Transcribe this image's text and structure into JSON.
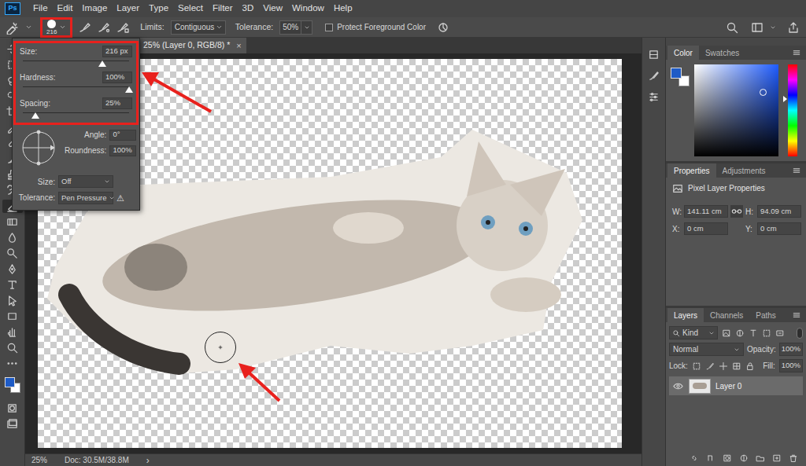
{
  "app": {
    "logo": "Ps"
  },
  "menu": [
    "File",
    "Edit",
    "Image",
    "Layer",
    "Type",
    "Select",
    "Filter",
    "3D",
    "View",
    "Window",
    "Help"
  ],
  "options_bar": {
    "brush_size": "216",
    "limits_label": "Limits:",
    "limits_value": "Contiguous",
    "tolerance_label": "Tolerance:",
    "tolerance_value": "50%",
    "protect_label": "Protect Foreground Color",
    "protect_checked": false
  },
  "brush_panel": {
    "sliders": [
      {
        "label": "Size:",
        "value": "216 px",
        "level": 0.75
      },
      {
        "label": "Hardness:",
        "value": "100%",
        "level": 1
      },
      {
        "label": "Spacing:",
        "value": "25%",
        "level": 0.12
      }
    ],
    "angle_label": "Angle:",
    "angle_value": "0°",
    "roundness_label": "Roundness:",
    "roundness_value": "100%",
    "controls": [
      {
        "label": "Size:",
        "value": "Off",
        "warning": false
      },
      {
        "label": "Tolerance:",
        "value": "Pen Pressure",
        "warning": true
      }
    ],
    "warning_icon": "⚠"
  },
  "document": {
    "tab": "25% (Layer 0, RGB/8) *",
    "close": "×"
  },
  "status_bar": {
    "zoom": "25%",
    "doc": "Doc: 30.5M/38.8M",
    "more": "›"
  },
  "swatches": [
    {
      "name": "foreground",
      "color": "#1e5bc6"
    },
    {
      "name": "background",
      "color": "#ffffff"
    }
  ],
  "color_panel": {
    "tabs": [
      {
        "label": "Color",
        "selected": true
      },
      {
        "label": "Swatches",
        "selected": false
      }
    ]
  },
  "properties": {
    "tabs": [
      {
        "label": "Properties",
        "selected": true
      },
      {
        "label": "Adjustments",
        "selected": false
      }
    ],
    "title": "Pixel Layer Properties",
    "fields": [
      {
        "label": "W:",
        "value": "141.11 cm"
      },
      {
        "label": "H:",
        "value": "94.09 cm"
      },
      {
        "label": "X:",
        "value": "0 cm"
      },
      {
        "label": "Y:",
        "value": "0 cm"
      }
    ]
  },
  "layers": {
    "tabs": [
      {
        "label": "Layers",
        "selected": true
      },
      {
        "label": "Channels",
        "selected": false
      },
      {
        "label": "Paths",
        "selected": false
      }
    ],
    "filter": "Kind",
    "blend_mode": "Normal",
    "opacity_label": "Opacity:",
    "opacity": "100%",
    "lock_label": "Lock:",
    "fill_label": "Fill:",
    "fill": "100%",
    "items": [
      {
        "name": "Layer 0",
        "visible": true,
        "selected": true
      }
    ]
  }
}
